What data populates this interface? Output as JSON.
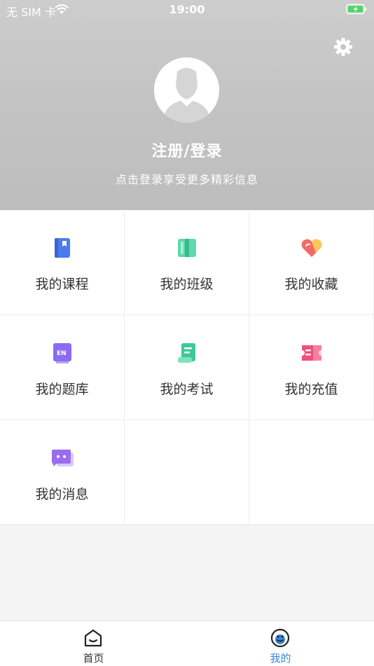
{
  "status_bar": {
    "carrier": "无 SIM 卡",
    "time": "19:00"
  },
  "header": {
    "title": "注册/登录",
    "subtitle": "点击登录享受更多精彩信息"
  },
  "menu": {
    "items": [
      {
        "label": "我的课程",
        "icon": "book-icon",
        "color": "#4a7cf0"
      },
      {
        "label": "我的班级",
        "icon": "open-book-icon",
        "color": "#4fd1a5"
      },
      {
        "label": "我的收藏",
        "icon": "heart-icon",
        "color": "#f06a6a"
      },
      {
        "label": "我的题库",
        "icon": "question-bank-icon",
        "color": "#8b6cf0"
      },
      {
        "label": "我的考试",
        "icon": "scroll-icon",
        "color": "#4fd1a5"
      },
      {
        "label": "我的充值",
        "icon": "ticket-icon",
        "color": "#ef4f7a"
      },
      {
        "label": "我的消息",
        "icon": "message-icon",
        "color": "#9a6cf0"
      }
    ]
  },
  "tabbar": {
    "tabs": [
      {
        "label": "首页",
        "icon": "home-icon",
        "active": false
      },
      {
        "label": "我的",
        "icon": "profile-face-icon",
        "active": true
      }
    ],
    "active_color": "#3a86d9"
  }
}
